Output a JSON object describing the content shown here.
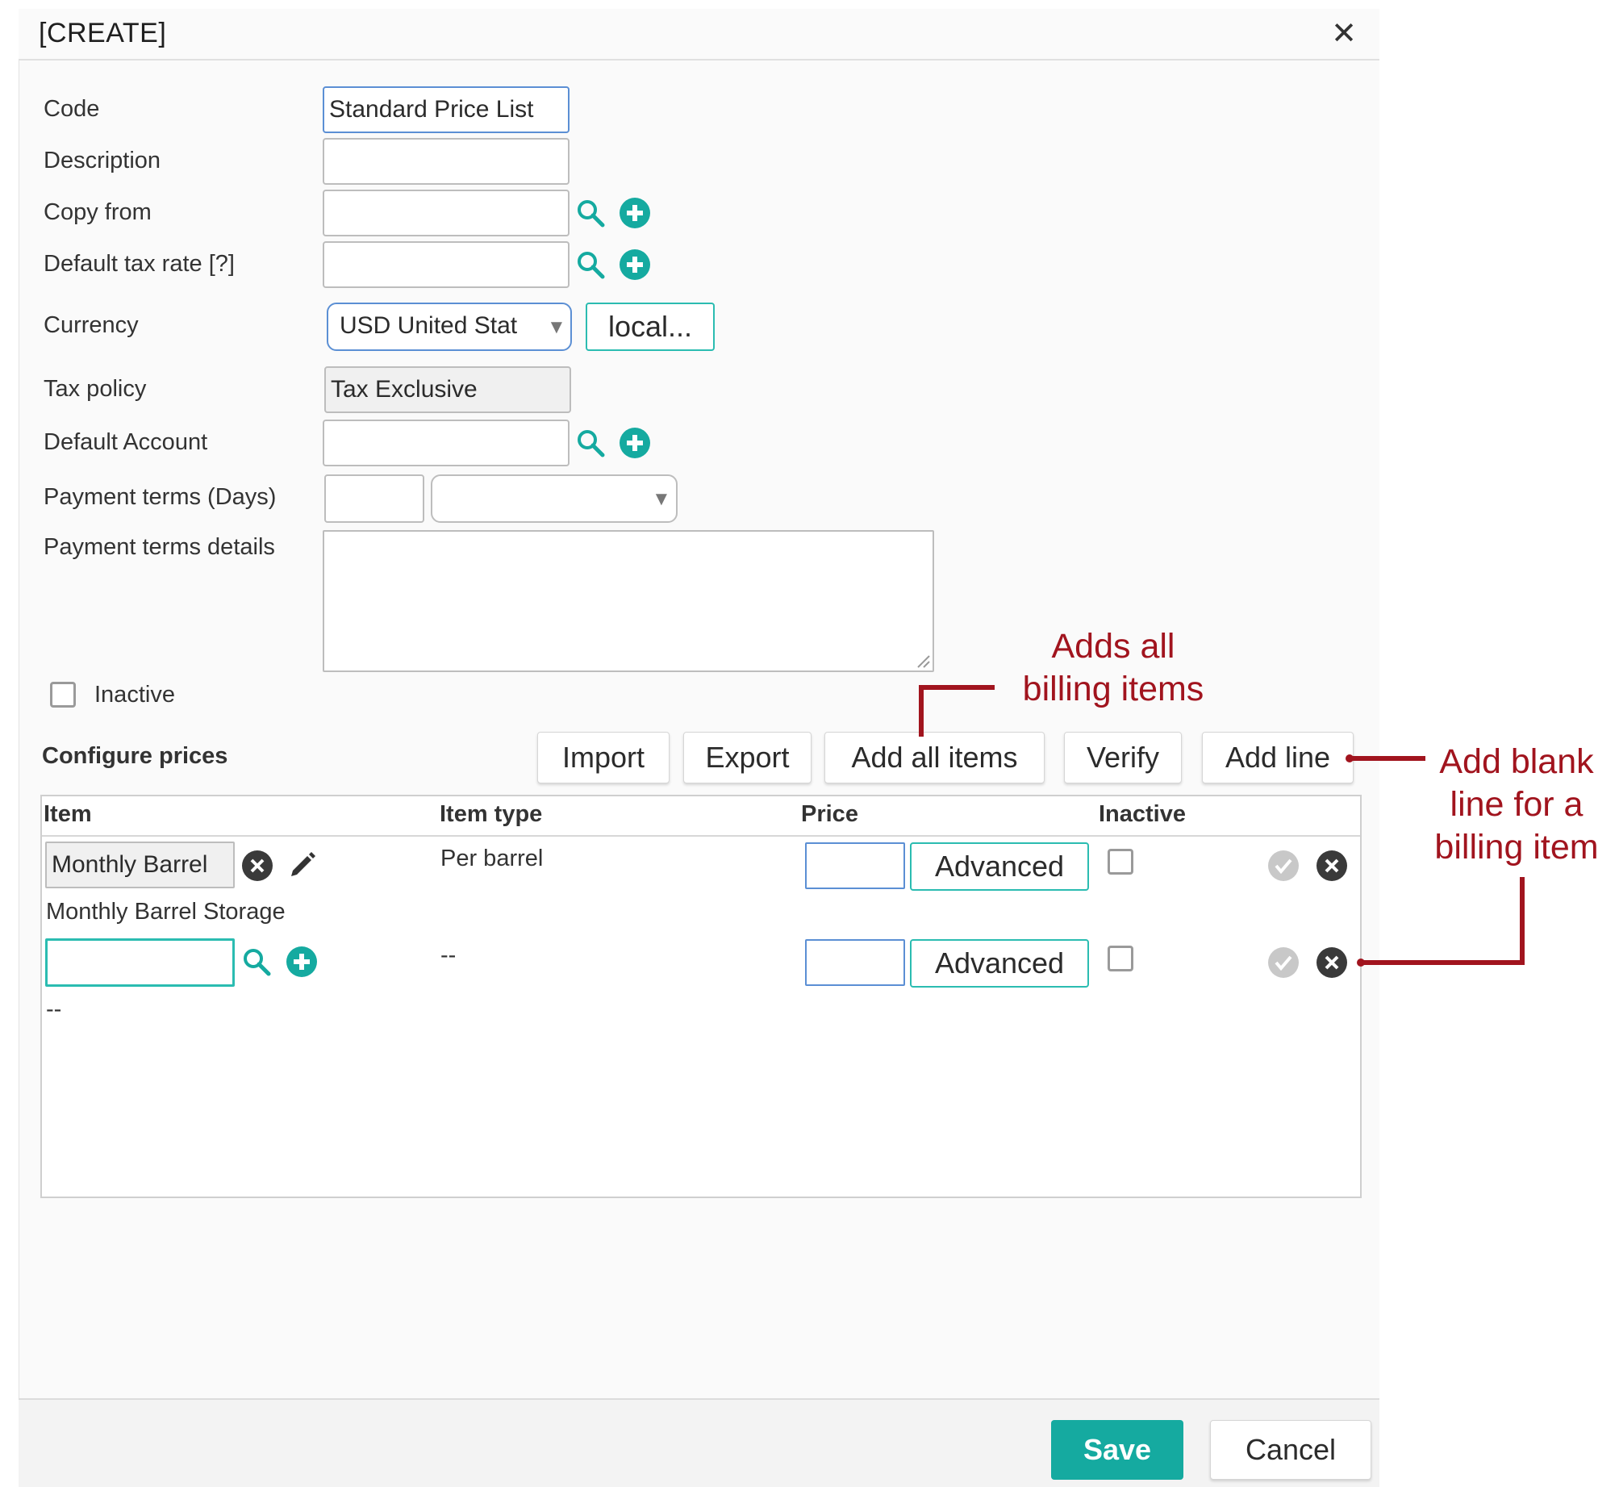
{
  "dialog": {
    "title": "[CREATE]",
    "close_symbol": "✕"
  },
  "form": {
    "code_label": "Code",
    "code_value": "Standard Price List",
    "description_label": "Description",
    "description_value": "",
    "copy_from_label": "Copy from",
    "copy_from_value": "",
    "tax_rate_label": "Default tax rate [?]",
    "tax_rate_value": "",
    "currency_label": "Currency",
    "currency_value": "USD United Stat",
    "currency_local_button": "local...",
    "tax_policy_label": "Tax policy",
    "tax_policy_value": "Tax Exclusive",
    "default_account_label": "Default Account",
    "default_account_value": "",
    "payment_terms_label": "Payment terms (Days)",
    "payment_terms_days": "",
    "payment_terms_option": "",
    "payment_details_label": "Payment terms details",
    "payment_details_value": "",
    "inactive_label": "Inactive",
    "inactive_checked": false
  },
  "prices": {
    "section_label": "Configure prices",
    "buttons": {
      "import": "Import",
      "export": "Export",
      "add_all": "Add all items",
      "verify": "Verify",
      "add_line": "Add line"
    },
    "columns": {
      "item": "Item",
      "item_type": "Item type",
      "price": "Price",
      "inactive": "Inactive"
    },
    "rows": [
      {
        "item_value": "Monthly Barrel",
        "item_description": "Monthly Barrel Storage",
        "item_type": "Per barrel",
        "price": "",
        "advanced_label": "Advanced",
        "inactive": false
      },
      {
        "item_value": "",
        "item_description": "--",
        "item_type": "--",
        "price": "",
        "advanced_label": "Advanced",
        "inactive": false
      }
    ]
  },
  "annotations": {
    "add_all_line1": "Adds all",
    "add_all_line2": "billing items",
    "add_line_line1": "Add blank",
    "add_line_line2": "line for a",
    "add_line_line3": "billing item",
    "color": "#a1141e"
  },
  "footer": {
    "save": "Save",
    "cancel": "Cancel"
  },
  "colors": {
    "accent_teal": "#15aaa0",
    "focus_blue": "#5b8fd4"
  }
}
